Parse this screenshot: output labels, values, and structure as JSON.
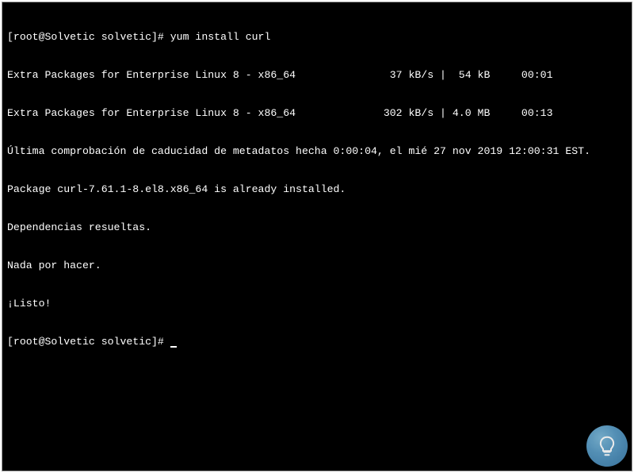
{
  "terminal": {
    "lines": [
      "[root@Solvetic solvetic]# yum install curl",
      "Extra Packages for Enterprise Linux 8 - x86_64               37 kB/s |  54 kB     00:01",
      "Extra Packages for Enterprise Linux 8 - x86_64              302 kB/s | 4.0 MB     00:13",
      "Última comprobación de caducidad de metadatos hecha 0:00:04, el mié 27 nov 2019 12:00:31 EST.",
      "Package curl-7.61.1-8.el8.x86_64 is already installed.",
      "Dependencias resueltas.",
      "Nada por hacer.",
      "¡Listo!"
    ],
    "prompt": "[root@Solvetic solvetic]# "
  },
  "watermark": {
    "name": "solvetic-logo"
  }
}
